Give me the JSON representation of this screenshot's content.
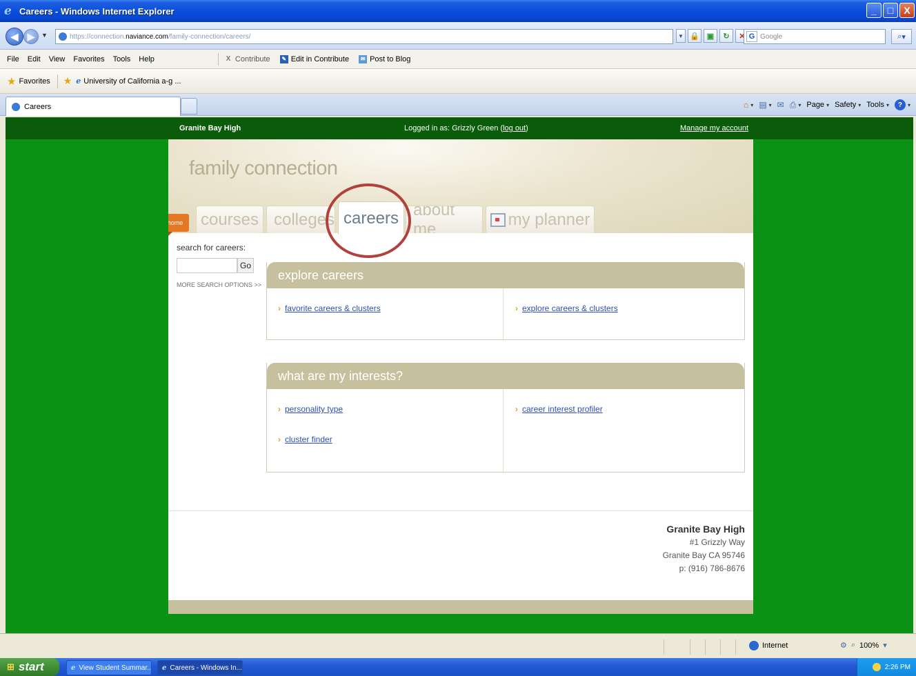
{
  "window": {
    "title": "Careers - Windows Internet Explorer",
    "minimize": "_",
    "maximize": "□",
    "close": "X"
  },
  "address_bar": {
    "url_prefix": "https://",
    "url_sub": "connection.",
    "url_domain": "naviance.com",
    "url_path": "/family-connection/careers/",
    "search_placeholder": "Google"
  },
  "menu": {
    "items": [
      "File",
      "Edit",
      "View",
      "Favorites",
      "Tools",
      "Help"
    ],
    "contribute": "Contribute",
    "edit_in_contribute": "Edit in Contribute",
    "post_to_blog": "Post to Blog"
  },
  "favorites_bar": {
    "label": "Favorites",
    "link": "University of California a-g ..."
  },
  "tab_row": {
    "tab_title": "Careers",
    "page_menu": "Page",
    "safety_menu": "Safety",
    "tools_menu": "Tools"
  },
  "site": {
    "school_name": "Granite Bay High",
    "logged_in_prefix": "Logged in as: Grizzly Green (",
    "logout_link": "log out",
    "logged_in_suffix": ")",
    "manage_account": "Manage my account",
    "brand": "family connection",
    "tabs": {
      "home": "home",
      "courses": "courses",
      "colleges": "colleges",
      "careers": "careers",
      "about_me": "about me",
      "my_planner": "my planner"
    },
    "search": {
      "label": "search for careers:",
      "go": "Go",
      "more_options": "MORE SEARCH OPTIONS >>"
    },
    "explore_panel": {
      "title": "explore careers",
      "links": [
        "favorite careers & clusters",
        "explore careers & clusters"
      ]
    },
    "interests_panel": {
      "title": "what are my interests?",
      "links": [
        "personality type",
        "career interest profiler",
        "cluster finder"
      ]
    },
    "footer": {
      "school_name": "Granite Bay High",
      "street": "#1 Grizzly Way",
      "city": "Granite Bay CA 95746",
      "phone": "p: (916) 786-8676"
    }
  },
  "status_bar": {
    "zone": "Internet",
    "zoom": "100%"
  },
  "taskbar": {
    "start": "start",
    "tasks": [
      "View Student Summar...",
      "Careers - Windows In..."
    ],
    "clock": "2:26 PM"
  },
  "colors": {
    "page_background": "#0b9214",
    "top_strip": "#0a5c0a",
    "panel_header": "#c7c09f",
    "home_tab": "#e37a23",
    "highlight_ring": "#b0413e",
    "link": "#2e4fb3"
  }
}
